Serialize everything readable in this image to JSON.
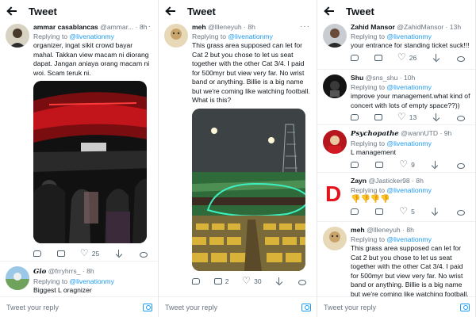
{
  "screens": [
    {
      "title": "Tweet",
      "tweets": [
        {
          "name": "ammar casablancas",
          "handle": "@ammar...",
          "time": "· 8h",
          "replying_to": "@livenationmy",
          "text": "organizer, ingat sikit crowd bayar mahal. Takkan view macam ni diorang dapat. Jangan aniaya orang macam ni woi. Scam teruk ni.",
          "likes": "25"
        },
        {
          "name": "Gio",
          "handle": "@frryhrrs_",
          "time": "· 8h",
          "replying_to": "@livenationmy",
          "text": "Biggest L oragnizer"
        }
      ],
      "reply_placeholder": "Tweet your reply"
    },
    {
      "title": "Tweet",
      "tweets": [
        {
          "name": "meh",
          "handle": "@llleneyuh",
          "time": "· 8h",
          "replying_to": "@livenationmy",
          "text": "This grass area supposed can let for Cat 2 but you chose to let us seat together with the other Cat 3/4. I paid for 500myr but view very far. No wrist band or anything. Billie is a big name but we're coming like watching football. What is this?",
          "retweets": "2",
          "likes": "30"
        }
      ],
      "reply_placeholder": "Tweet your reply"
    },
    {
      "title": "Tweet",
      "tweets": [
        {
          "name": "Zahid Mansor",
          "handle": "@ZahidMansor",
          "time": "· 13h",
          "replying_to": "@livenationmy",
          "text": "your entrance for standing ticket suck!!!",
          "likes": "26"
        },
        {
          "name": "Shu",
          "handle": "@sns_shu",
          "time": "· 10h",
          "replying_to": "@livenationmy",
          "text": "improve your management.what kind of concert with lots of empty space??))",
          "likes": "13"
        },
        {
          "name": "Psychopathe",
          "handle": "@wannUTD",
          "time": "· 9h",
          "replying_to": "@livenationmy",
          "text": "L management",
          "likes": "9"
        },
        {
          "name": "Zayn",
          "handle": "@Jasticker98",
          "time": "· 8h",
          "replying_to": "@livenationmy",
          "text": "👎👎👎👎",
          "likes": "5"
        },
        {
          "name": "meh",
          "handle": "@llleneyuh",
          "time": "· 8h",
          "replying_to": "@livenationmy",
          "text": "This grass area supposed can let for Cat 2 but you chose to let us seat together with the other Cat 3/4. I paid for 500myr but view very far. No wrist band or anything. Billie is a big name but we're coming like watching football."
        }
      ],
      "reply_placeholder": "Tweet your reply"
    }
  ],
  "overlay_letter": "D"
}
